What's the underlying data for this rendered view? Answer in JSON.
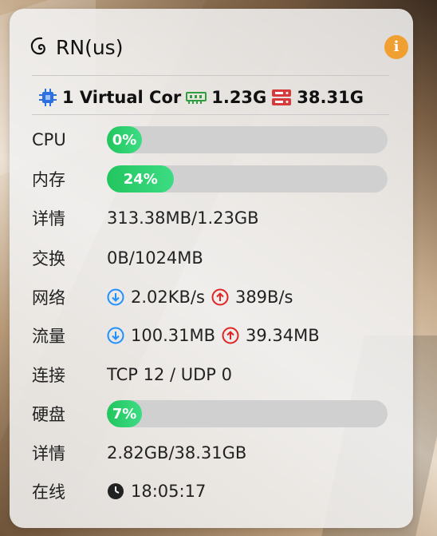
{
  "header": {
    "title": "RN(us)",
    "logo_icon": "debian-swirl-icon",
    "info_icon": "info-icon"
  },
  "specs": {
    "cpu": "1 Virtual Cor",
    "ram": "1.23G",
    "disk": "38.31G"
  },
  "rows": {
    "cpu": {
      "label": "CPU",
      "percent_text": "0%",
      "percent": 0
    },
    "mem": {
      "label": "内存",
      "percent_text": "24%",
      "percent": 24
    },
    "mem_detail": {
      "label": "详情",
      "value": "313.38MB/1.23GB"
    },
    "swap": {
      "label": "交换",
      "value": "0B/1024MB"
    },
    "net": {
      "label": "网络",
      "down": "2.02KB/s",
      "up": "389B/s"
    },
    "traffic": {
      "label": "流量",
      "down": "100.31MB",
      "up": "39.34MB"
    },
    "conn": {
      "label": "连接",
      "value": "TCP 12 / UDP 0"
    },
    "disk": {
      "label": "硬盘",
      "percent_text": "7%",
      "percent": 7
    },
    "disk_detail": {
      "label": "详情",
      "value": "2.82GB/38.31GB"
    },
    "online": {
      "label": "在线",
      "value": "18:05:17"
    }
  },
  "colors": {
    "progress": "#22c55e",
    "download": "#1e90ff",
    "upload": "#e02424",
    "info": "#f0a030",
    "disk_icon": "#d63a3a",
    "cpu_icon": "#2b6fe0",
    "ram_icon": "#2e9e3e"
  }
}
